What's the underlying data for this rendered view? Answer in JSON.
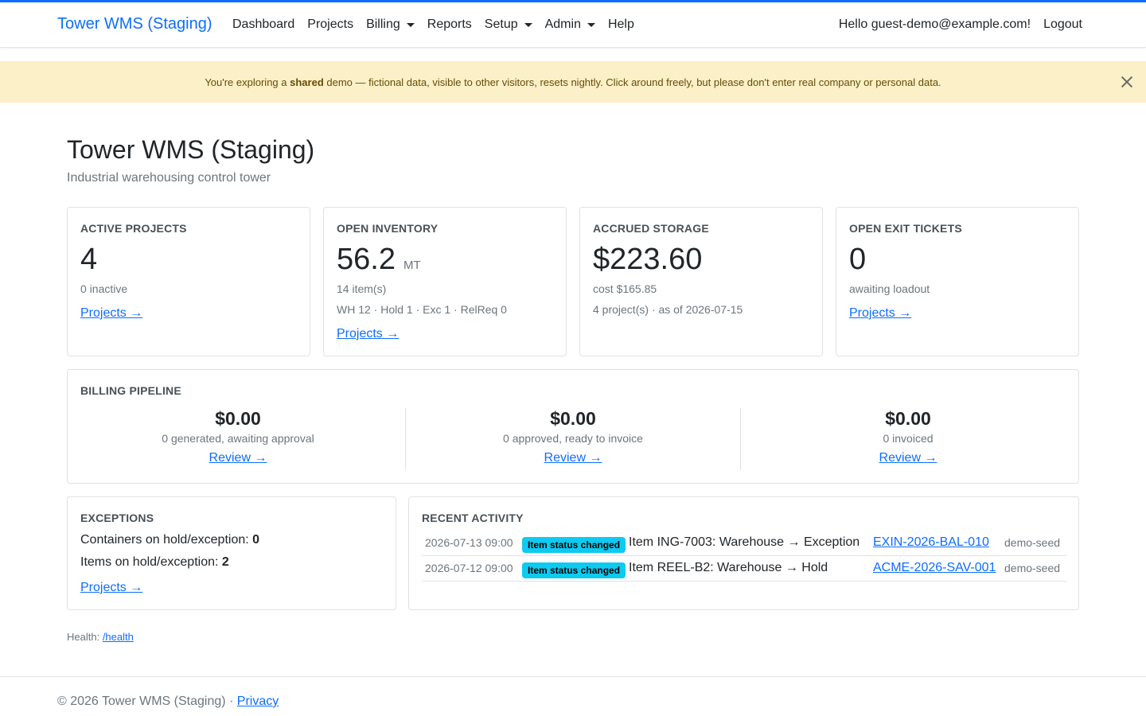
{
  "nav": {
    "brand": "Tower WMS (Staging)",
    "links": [
      "Dashboard",
      "Projects",
      "Billing",
      "Reports",
      "Setup",
      "Admin",
      "Help"
    ],
    "greeting": "Hello guest-demo@example.com!",
    "logout": "Logout"
  },
  "alert": {
    "pre": "You're exploring a ",
    "bold": "shared",
    "post": " demo — fictional data, visible to other visitors, resets nightly. Click around freely, but please don't enter real company or personal data."
  },
  "header": {
    "title": "Tower WMS (Staging)",
    "subtitle": "Industrial warehousing control tower"
  },
  "cards": {
    "active_projects": {
      "title": "ACTIVE PROJECTS",
      "value": "4",
      "line1": "0 inactive",
      "link": "Projects →"
    },
    "open_inventory": {
      "title": "OPEN INVENTORY",
      "value": "56.2",
      "unit": "MT",
      "line1": "14 item(s)",
      "line2": "WH 12 · Hold 1 · Exc 1 · RelReq 0",
      "link": "Projects →"
    },
    "accrued_storage": {
      "title": "ACCRUED STORAGE",
      "value": "$223.60",
      "line1": "cost $165.85",
      "line2": "4 project(s) · as of 2026-07-15"
    },
    "open_exit_tickets": {
      "title": "OPEN EXIT TICKETS",
      "value": "0",
      "line1": "awaiting loadout",
      "link": "Projects →"
    }
  },
  "billing": {
    "title": "BILLING PIPELINE",
    "cols": [
      {
        "amount": "$0.00",
        "desc": "0 generated, awaiting approval",
        "link": "Review →"
      },
      {
        "amount": "$0.00",
        "desc": "0 approved, ready to invoice",
        "link": "Review →"
      },
      {
        "amount": "$0.00",
        "desc": "0 invoiced",
        "link": "Review →"
      }
    ]
  },
  "exceptions": {
    "title": "EXCEPTIONS",
    "containers_label": "Containers on hold/exception: ",
    "containers_value": "0",
    "items_label": "Items on hold/exception: ",
    "items_value": "2",
    "link": "Projects →"
  },
  "activity": {
    "title": "RECENT ACTIVITY",
    "rows": [
      {
        "time": "2026-07-13 09:00",
        "badge": "Item status changed",
        "text": "Item ING-7003: Warehouse → Exception",
        "ref": "EXIN-2026-BAL-010",
        "user": "demo-seed"
      },
      {
        "time": "2026-07-12 09:00",
        "badge": "Item status changed",
        "text": "Item REEL-B2: Warehouse → Hold",
        "ref": "ACME-2026-SAV-001",
        "user": "demo-seed"
      }
    ]
  },
  "health": {
    "label": "Health: ",
    "link": "/health"
  },
  "footer": {
    "text": "© 2026 Tower WMS (Staging) · ",
    "privacy": "Privacy"
  },
  "colors": {
    "accent": "#0d6efd",
    "alert_bg": "#fcf0c8",
    "badge": "#0dcaf0"
  }
}
